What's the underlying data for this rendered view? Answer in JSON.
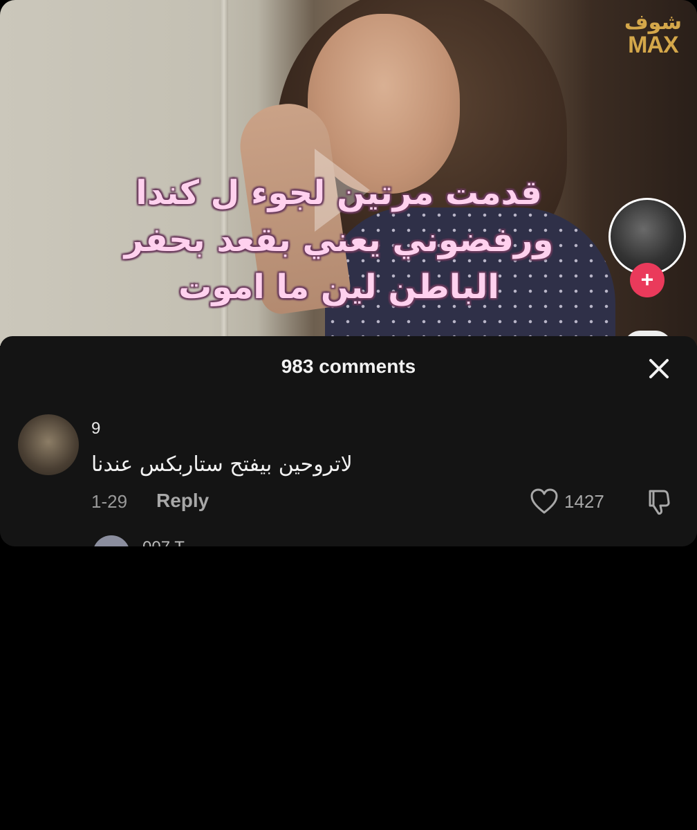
{
  "video": {
    "brand_logo_ar": "شوف",
    "brand_logo_en": "MAX",
    "caption_lines": [
      "قدمت مرتين لجوء ل كندا",
      "ورفضوني يعني بقعد بحفر",
      "الباطن لين ما اموت"
    ],
    "follow_symbol": "+"
  },
  "comments_sheet": {
    "title": "983 comments",
    "comments": [
      {
        "username": "9",
        "text": "لاتروحين بيفتح ستاربكس عندنا",
        "date": "1-29",
        "reply_label": "Reply",
        "like_count": "1427"
      }
    ],
    "next_username_partial": "007 T"
  },
  "colors": {
    "caption_fill": "#ffd1ee",
    "caption_outline": "#6a3b5c",
    "follow_button": "#ea3a5b",
    "sheet_background": "#141414",
    "logo": "#d4a74a"
  }
}
